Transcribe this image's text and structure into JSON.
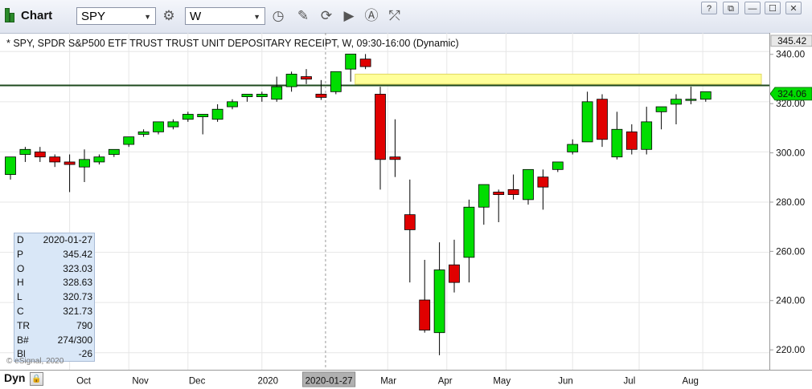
{
  "toolbar": {
    "title": "Chart",
    "symbol": "SPY",
    "interval": "W",
    "window_buttons": [
      "?",
      "⧉",
      "—",
      "☐",
      "✕"
    ]
  },
  "header": "* SPY, SPDR S&P500 ETF TRUST TRUST UNIT DEPOSITARY RECEIPT, W, 09:30-16:00 (Dynamic)",
  "price_labels": {
    "top": "345.42",
    "last": "324.06"
  },
  "cursor_date": "2020-01-27",
  "infobox": [
    {
      "k": "D",
      "v": "2020-01-27"
    },
    {
      "k": "P",
      "v": "345.42"
    },
    {
      "k": "O",
      "v": "323.03"
    },
    {
      "k": "H",
      "v": "328.63"
    },
    {
      "k": "L",
      "v": "320.73"
    },
    {
      "k": "C",
      "v": "321.73"
    },
    {
      "k": "TR",
      "v": "790"
    },
    {
      "k": "B#",
      "v": "274/300"
    },
    {
      "k": "Bl",
      "v": "-26"
    }
  ],
  "watermark": "© eSignal, 2020",
  "footer": {
    "dyn": "Dyn"
  },
  "colors": {
    "up": "#00dd00",
    "down": "#e00000",
    "hline": "#1e4a1e",
    "zone": "#ffff99"
  },
  "chart_data": {
    "type": "candlestick",
    "ylim": [
      212,
      345
    ],
    "yticks": [
      340,
      320,
      300,
      280,
      260,
      240,
      220
    ],
    "ytick_labels": [
      "340.00",
      "320.00",
      "300.00",
      "280.00",
      "260.00",
      "240.00",
      "220.00"
    ],
    "xtick_labels": [
      {
        "label": "Oct",
        "index": 4
      },
      {
        "label": "Nov",
        "index": 8
      },
      {
        "label": "Dec",
        "index": 12
      },
      {
        "label": "2020",
        "index": 17
      },
      {
        "label": "Mar",
        "index": 25.5
      },
      {
        "label": "Apr",
        "index": 29.5
      },
      {
        "label": "May",
        "index": 33.5
      },
      {
        "label": "Jun",
        "index": 38
      },
      {
        "label": "Jul",
        "index": 42.5
      },
      {
        "label": "Aug",
        "index": 46.8
      }
    ],
    "horizontal_line": 326.5,
    "zone": {
      "y_low": 327,
      "y_high": 331,
      "from_index": 23.3
    },
    "cursor_index": 21.3,
    "candles": [
      {
        "o": 291,
        "h": 298,
        "l": 289,
        "c": 298
      },
      {
        "o": 299,
        "h": 302,
        "l": 296,
        "c": 301
      },
      {
        "o": 300,
        "h": 302,
        "l": 296,
        "c": 298
      },
      {
        "o": 298,
        "h": 299,
        "l": 294,
        "c": 296
      },
      {
        "o": 296,
        "h": 299,
        "l": 284,
        "c": 295
      },
      {
        "o": 294,
        "h": 301,
        "l": 288,
        "c": 297
      },
      {
        "o": 296,
        "h": 299,
        "l": 295,
        "c": 298
      },
      {
        "o": 299,
        "h": 301,
        "l": 298,
        "c": 301
      },
      {
        "o": 303,
        "h": 306,
        "l": 302,
        "c": 306
      },
      {
        "o": 307,
        "h": 309,
        "l": 306,
        "c": 308
      },
      {
        "o": 308,
        "h": 312,
        "l": 307,
        "c": 312
      },
      {
        "o": 310,
        "h": 313,
        "l": 309,
        "c": 312
      },
      {
        "o": 313,
        "h": 316,
        "l": 312,
        "c": 315
      },
      {
        "o": 314,
        "h": 315,
        "l": 307,
        "c": 315
      },
      {
        "o": 313,
        "h": 319,
        "l": 312,
        "c": 317
      },
      {
        "o": 318,
        "h": 321,
        "l": 317,
        "c": 320
      },
      {
        "o": 322,
        "h": 323,
        "l": 320,
        "c": 323
      },
      {
        "o": 322,
        "h": 324,
        "l": 320,
        "c": 323
      },
      {
        "o": 321,
        "h": 330,
        "l": 320,
        "c": 326
      },
      {
        "o": 326,
        "h": 332,
        "l": 324,
        "c": 331
      },
      {
        "o": 330,
        "h": 333,
        "l": 327,
        "c": 329
      },
      {
        "o": 323.03,
        "h": 328.63,
        "l": 320.73,
        "c": 321.73
      },
      {
        "o": 324,
        "h": 332,
        "l": 323,
        "c": 332
      },
      {
        "o": 333,
        "h": 339,
        "l": 328,
        "c": 339
      },
      {
        "o": 337,
        "h": 339,
        "l": 333,
        "c": 334
      },
      {
        "o": 323,
        "h": 326,
        "l": 285,
        "c": 297
      },
      {
        "o": 298,
        "h": 313,
        "l": 290,
        "c": 297
      },
      {
        "o": 275,
        "h": 289,
        "l": 248,
        "c": 269
      },
      {
        "o": 241,
        "h": 257,
        "l": 228,
        "c": 229
      },
      {
        "o": 228,
        "h": 264,
        "l": 219,
        "c": 253
      },
      {
        "o": 255,
        "h": 265,
        "l": 244,
        "c": 248
      },
      {
        "o": 258,
        "h": 281,
        "l": 248,
        "c": 278
      },
      {
        "o": 278,
        "h": 286,
        "l": 271,
        "c": 287
      },
      {
        "o": 284,
        "h": 285,
        "l": 272,
        "c": 283
      },
      {
        "o": 285,
        "h": 291,
        "l": 281,
        "c": 283
      },
      {
        "o": 281,
        "h": 293,
        "l": 279,
        "c": 293
      },
      {
        "o": 290,
        "h": 293,
        "l": 277,
        "c": 286
      },
      {
        "o": 293,
        "h": 296,
        "l": 292,
        "c": 296
      },
      {
        "o": 300,
        "h": 305,
        "l": 299,
        "c": 303
      },
      {
        "o": 304,
        "h": 324,
        "l": 304,
        "c": 320
      },
      {
        "o": 321,
        "h": 323,
        "l": 302,
        "c": 305
      },
      {
        "o": 298,
        "h": 316,
        "l": 297,
        "c": 309
      },
      {
        "o": 308,
        "h": 311,
        "l": 299,
        "c": 301
      },
      {
        "o": 301,
        "h": 318,
        "l": 299,
        "c": 312
      },
      {
        "o": 316,
        "h": 318,
        "l": 309,
        "c": 318
      },
      {
        "o": 319,
        "h": 323,
        "l": 311,
        "c": 321
      },
      {
        "o": 321,
        "h": 326,
        "l": 319,
        "c": 321
      },
      {
        "o": 321,
        "h": 324,
        "l": 320,
        "c": 324
      }
    ]
  }
}
